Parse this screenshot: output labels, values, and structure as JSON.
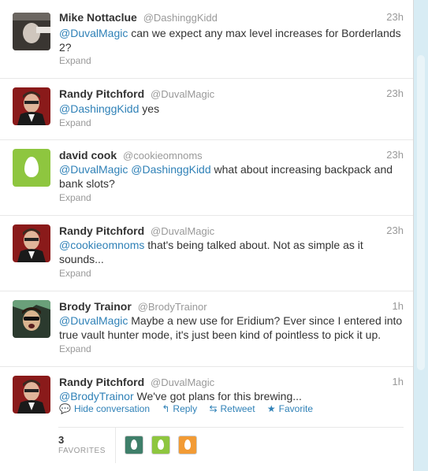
{
  "tweets": [
    {
      "fullname": "Mike Nottaclue",
      "username": "@DashinggKidd",
      "time": "23h",
      "parts": [
        {
          "t": "@DuvalMagic",
          "mention": true
        },
        {
          "t": " can we expect any max level increases for Borderlands 2?",
          "mention": false
        }
      ],
      "expand": "Expand"
    },
    {
      "fullname": "Randy Pitchford",
      "username": "@DuvalMagic",
      "time": "23h",
      "parts": [
        {
          "t": "@DashinggKidd",
          "mention": true
        },
        {
          "t": " yes",
          "mention": false
        }
      ],
      "expand": "Expand"
    },
    {
      "fullname": "david cook",
      "username": "@cookieomnoms",
      "time": "23h",
      "parts": [
        {
          "t": "@DuvalMagic",
          "mention": true
        },
        {
          "t": " ",
          "mention": false
        },
        {
          "t": "@DashinggKidd",
          "mention": true
        },
        {
          "t": " what about increasing backpack and bank slots?",
          "mention": false
        }
      ],
      "expand": "Expand"
    },
    {
      "fullname": "Randy Pitchford",
      "username": "@DuvalMagic",
      "time": "23h",
      "parts": [
        {
          "t": "@cookieomnoms",
          "mention": true
        },
        {
          "t": " that's being talked about. Not as simple as it sounds...",
          "mention": false
        }
      ],
      "expand": "Expand"
    },
    {
      "fullname": "Brody Trainor",
      "username": "@BrodyTrainor",
      "time": "1h",
      "parts": [
        {
          "t": "@DuvalMagic",
          "mention": true
        },
        {
          "t": " Maybe a new use for Eridium? Ever since I entered into true vault hunter mode, it's just been kind of pointless to pick it up.",
          "mention": false
        }
      ],
      "expand": "Expand"
    },
    {
      "fullname": "Randy Pitchford",
      "username": "@DuvalMagic",
      "time": "1h",
      "parts": [
        {
          "t": "@BrodyTrainor",
          "mention": true
        },
        {
          "t": " We've got plans for this brewing...",
          "mention": false
        }
      ],
      "expand": ""
    }
  ],
  "actions": {
    "hide": "Hide conversation",
    "reply": "Reply",
    "retweet": "Retweet",
    "favorite": "Favorite"
  },
  "stats": {
    "count": "3",
    "label": "FAVORITES"
  },
  "colors": {
    "link": "#2f81b7",
    "egg_bg": "#8ec63f",
    "fav1": "#3f7f6a",
    "fav2": "#8ec63f",
    "fav3": "#f29b35"
  }
}
